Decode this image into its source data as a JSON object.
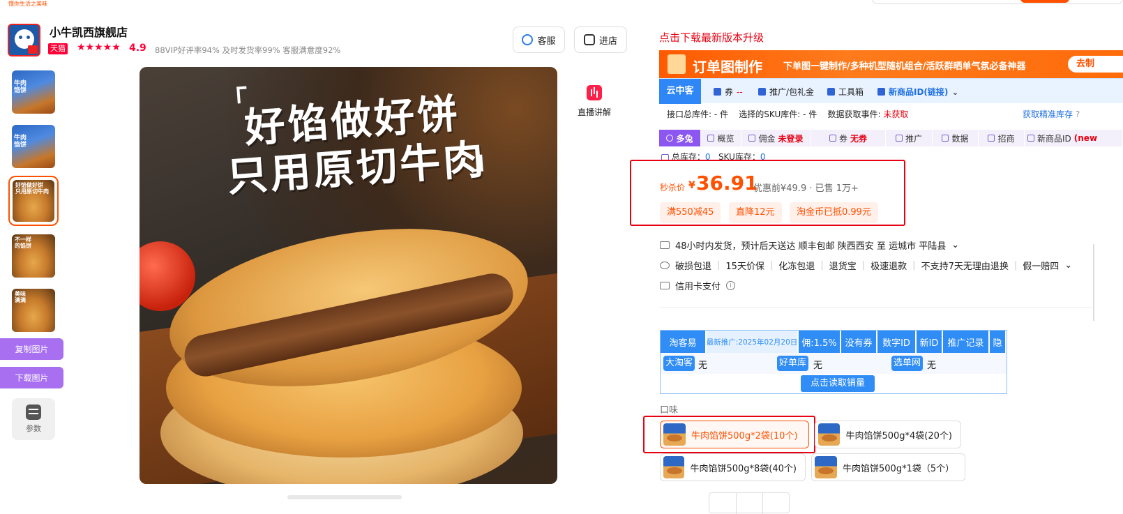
{
  "top": {
    "tiny_text": "懂你生活之美味"
  },
  "shop": {
    "name": "小牛凯西旗舰店",
    "tmall": "天猫",
    "stars": "★★★★★",
    "rating": "4.9",
    "stats": "88VIP好评率94%   及时发货率99%   客服满意度92%",
    "service_btn": "客服",
    "enter_btn": "进店"
  },
  "gallery": {
    "thumbs": [
      {
        "label": "牛肉\n馅饼"
      },
      {
        "label": "牛肉\n馅饼"
      },
      {
        "label": "好馅做好饼\n只用原切牛肉"
      },
      {
        "label": "不一样\n的馅饼"
      },
      {
        "label": "美味\n满满"
      }
    ],
    "copy_btn": "复制图片",
    "download_btn": "下载图片",
    "params": "参数"
  },
  "main_image": {
    "line1": "好馅做好饼",
    "line2": "只用原切牛肉"
  },
  "live": "直播讲解",
  "plugin": {
    "upgrade": "点击下载最新版本升级",
    "banner_title": "订单图制作",
    "banner_desc": "下单图一键制作/多种机型随机组合/活跃群晒单气氛必备神器",
    "banner_cta": "去制",
    "yzk_brand": "云中客",
    "yzk_coupon": "券",
    "yzk_coupon_val": "--",
    "yzk_promo": "推广/包礼金",
    "yzk_tools": "工具箱",
    "yzk_newid": "新商品ID(链接)",
    "info_total": "接口总库件: -  件",
    "info_sku": "选择的SKU库件:  -  件",
    "info_event": "数据获取事件: ",
    "info_event_val": "未获取",
    "info_precise": "获取精准库存",
    "toolbar": [
      {
        "label": "多兔"
      },
      {
        "label": "概览"
      },
      {
        "label": "佣金",
        "value": "未登录"
      },
      {
        "label": "券",
        "value": "无券"
      },
      {
        "label": "推广"
      },
      {
        "label": "数据"
      },
      {
        "label": "招商"
      },
      {
        "label": "新商品ID",
        "value": "(new"
      }
    ],
    "stock_total": "总库存：",
    "stock_total_val": "0",
    "stock_sku": "SKU库存：",
    "stock_sku_val": "0"
  },
  "price": {
    "label": "秒杀价",
    "currency": "¥",
    "value": "36.91",
    "sub": "优惠前¥49.9 · 已售 1万+",
    "tags": [
      "满550减45",
      "直降12元",
      "淘金币已抵0.99元"
    ]
  },
  "services": {
    "ship": "48小时内发货，预计后天送达   顺丰包邮   陕西西安 至 运城市 平陆县",
    "guarantees": [
      "破损包退",
      "15天价保",
      "化冻包退",
      "退货宝",
      "极速退款",
      "不支持7天无理由退换",
      "假一赔四"
    ],
    "credit": "信用卡支付"
  },
  "taokeyi": {
    "brand": "淘客易",
    "date": "最新推广:2025年02月20日",
    "buttons": [
      "佣:1.5%",
      "没有券",
      "数字ID",
      "新ID",
      "推广记录",
      "隐"
    ],
    "dataoke": "大淘客",
    "dataoke_val": "无",
    "haodanku": "好单库",
    "haodanku_val": "无",
    "xuandan": "选单网",
    "xuandan_val": "无",
    "read_sales": "点击读取销量"
  },
  "sku": {
    "label": "口味",
    "options": [
      "牛肉馅饼500g*2袋(10个)",
      "牛肉馅饼500g*4袋(20个)",
      "牛肉馅饼500g*8袋(40个)",
      "牛肉馅饼500g*1袋（5个）"
    ],
    "selected_index": 0
  },
  "colors": {
    "accent": "#ff5000",
    "alert_red": "#e60012",
    "plugin_blue": "#2f8df5",
    "purple": "#a86ff0"
  }
}
